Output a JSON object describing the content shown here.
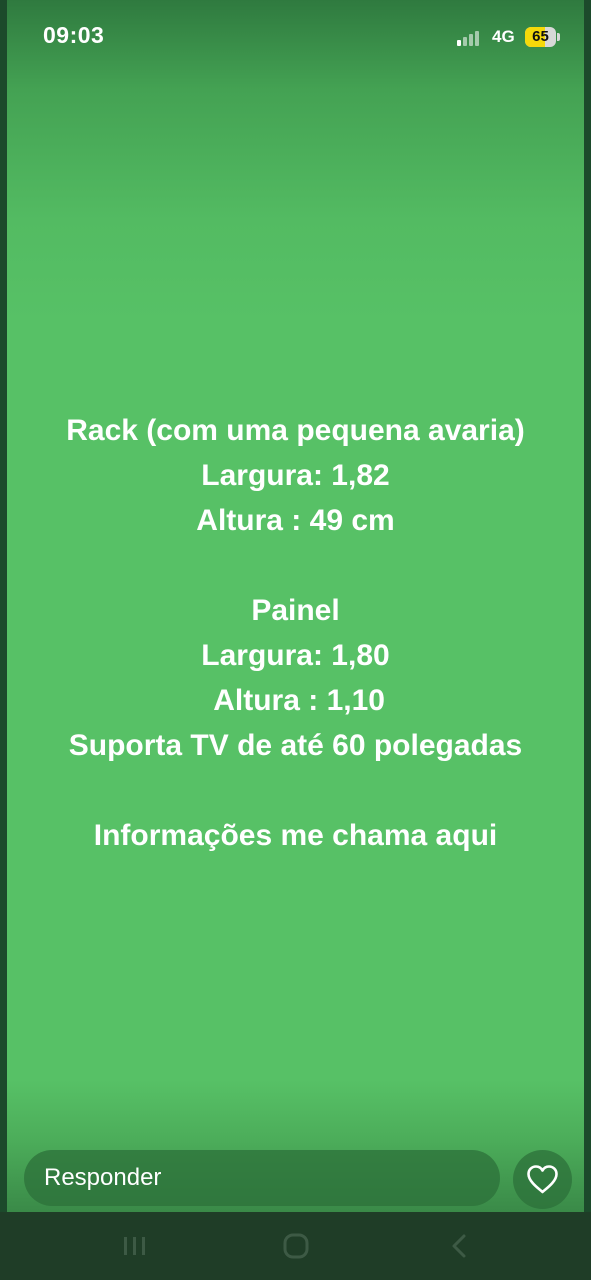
{
  "status_bar": {
    "time": "09:03",
    "network": "4G",
    "battery": "65",
    "battery_level": 0.65,
    "icons": [
      "signal-icon",
      "battery-icon"
    ]
  },
  "story": {
    "background_color": "#57c166",
    "lines": [
      "Rack (com uma pequena avaria)",
      "Largura: 1,82",
      "Altura : 49 cm",
      "",
      "Painel",
      "Largura: 1,80",
      " Altura : 1,10",
      "Suporta TV de até 60 polegadas",
      "",
      "Informações me chama aqui"
    ]
  },
  "reply": {
    "label": "Responder",
    "like_icon": "heart-icon"
  },
  "nav": {
    "icons": [
      "recent-apps-icon",
      "home-icon",
      "back-icon"
    ]
  }
}
